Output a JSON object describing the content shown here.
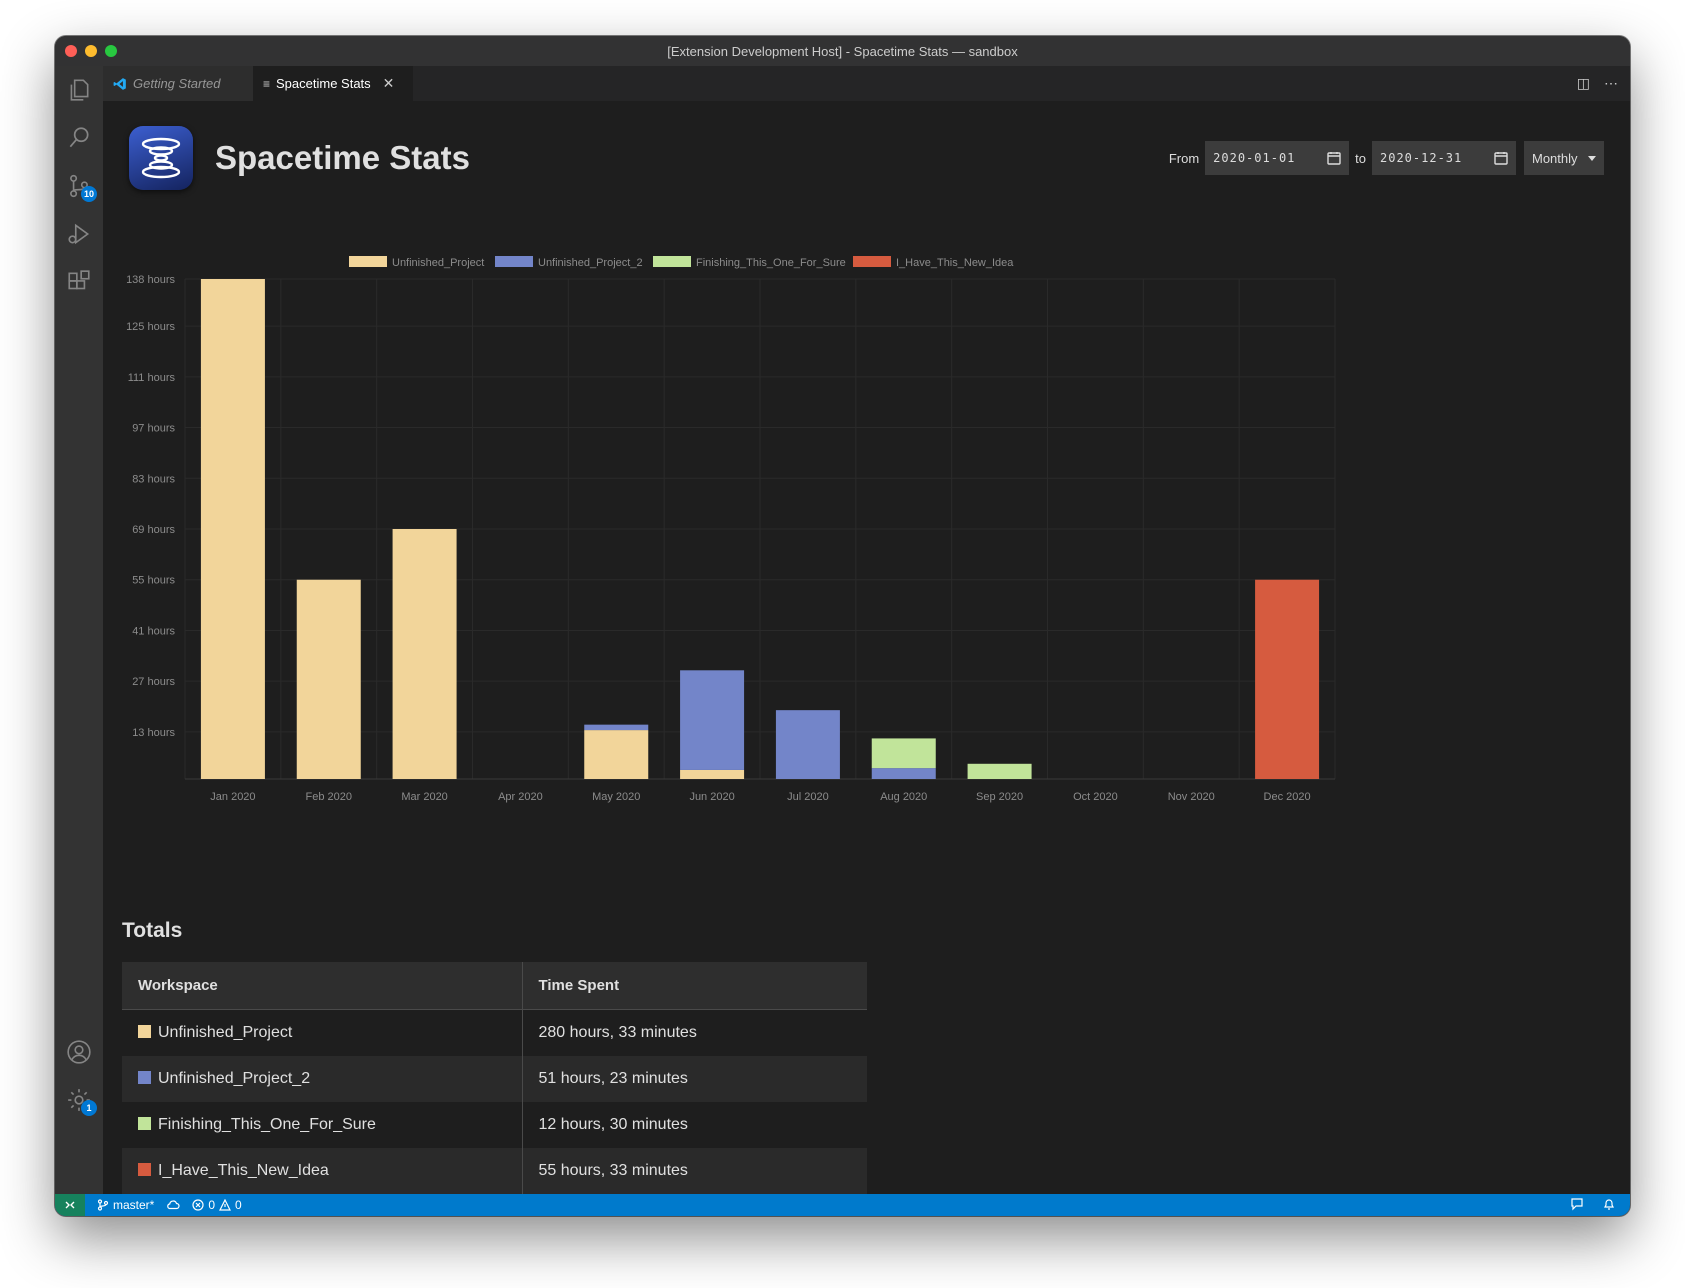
{
  "window": {
    "title": "[Extension Development Host] - Spacetime Stats — sandbox"
  },
  "activity_bar": {
    "scm_badge": "10",
    "settings_badge": "1"
  },
  "tabs": [
    {
      "label": "Getting Started",
      "icon": "vscode-logo-icon"
    },
    {
      "label": "Spacetime Stats",
      "icon": "preview-icon"
    }
  ],
  "header": {
    "title": "Spacetime Stats"
  },
  "range": {
    "from_label": "From",
    "from_value": "2020-01-01",
    "to_label": "to",
    "to_value": "2020-12-31",
    "granularity": "Monthly"
  },
  "chart_data": {
    "type": "bar",
    "stacked": true,
    "categories": [
      "Jan 2020",
      "Feb 2020",
      "Mar 2020",
      "Apr 2020",
      "May 2020",
      "Jun 2020",
      "Jul 2020",
      "Aug 2020",
      "Sep 2020",
      "Oct 2020",
      "Nov 2020",
      "Dec 2020"
    ],
    "y_ticks": [
      "138 hours",
      "125 hours",
      "111 hours",
      "97 hours",
      "83 hours",
      "69 hours",
      "55 hours",
      "41 hours",
      "27 hours",
      "13 hours"
    ],
    "ylim": [
      0,
      138
    ],
    "grid": true,
    "legend_position": "top",
    "series": [
      {
        "name": "Unfinished_Project",
        "color": "#f2d59a",
        "values": [
          138,
          55,
          69,
          0,
          13.5,
          2.5,
          0,
          0,
          0,
          0,
          0,
          0
        ]
      },
      {
        "name": "Unfinished_Project_2",
        "color": "#7385c9",
        "values": [
          0,
          0,
          0,
          0,
          1.5,
          27.5,
          19,
          3,
          0,
          0,
          0,
          0
        ]
      },
      {
        "name": "Finishing_This_One_For_Sure",
        "color": "#c1e49a",
        "values": [
          0,
          0,
          0,
          0,
          0,
          0,
          0,
          8.2,
          4.2,
          0,
          0,
          0
        ]
      },
      {
        "name": "I_Have_This_New_Idea",
        "color": "#d65b3f",
        "values": [
          0,
          0,
          0,
          0,
          0,
          0,
          0,
          0,
          0,
          0,
          0,
          55
        ]
      }
    ]
  },
  "totals": {
    "title": "Totals",
    "headers": [
      "Workspace",
      "Time Spent"
    ],
    "rows": [
      {
        "workspace": "Unfinished_Project",
        "time": "280 hours, 33 minutes",
        "color": "#f2d59a"
      },
      {
        "workspace": "Unfinished_Project_2",
        "time": "51 hours, 23 minutes",
        "color": "#7385c9"
      },
      {
        "workspace": "Finishing_This_One_For_Sure",
        "time": "12 hours, 30 minutes",
        "color": "#c1e49a"
      },
      {
        "workspace": "I_Have_This_New_Idea",
        "time": "55 hours, 33 minutes",
        "color": "#d65b3f"
      }
    ]
  },
  "status_bar": {
    "branch": "master*",
    "errors": "0",
    "warnings": "0"
  }
}
